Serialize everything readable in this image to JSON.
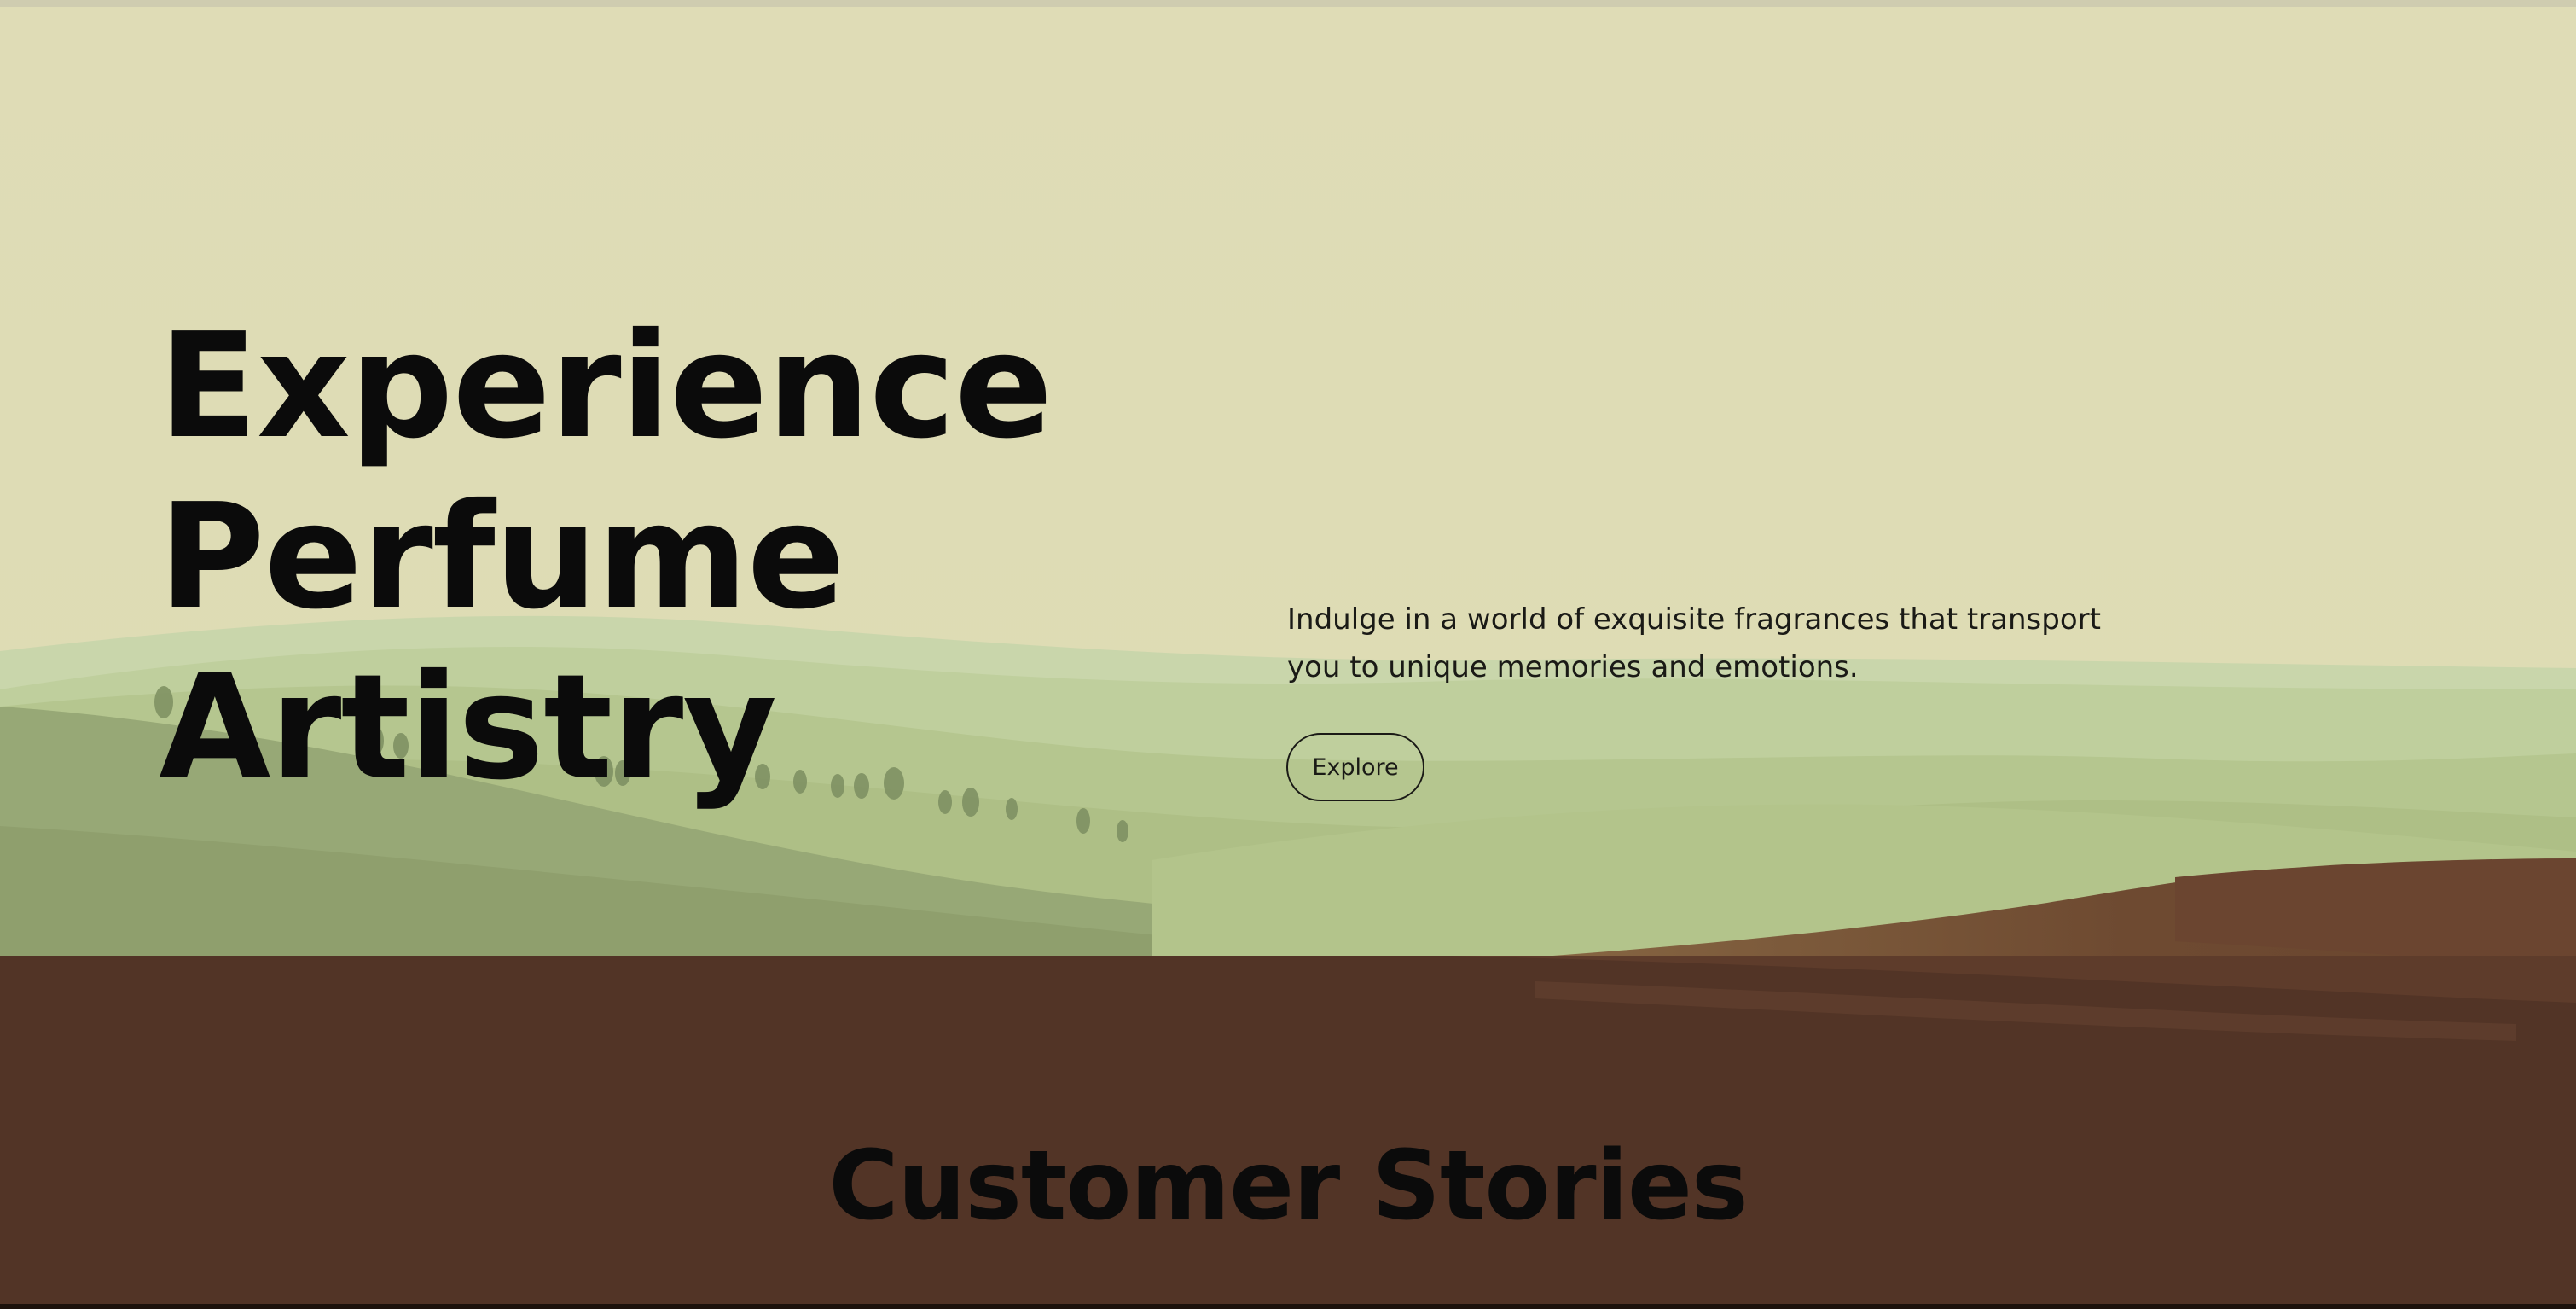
{
  "hero": {
    "title_lines": [
      "Experience",
      "Perfume",
      "Artistry"
    ],
    "description": "Indulge in a world of exquisite fragrances that transport you to unique memories and emotions.",
    "explore_label": "Explore"
  },
  "stories": {
    "title": "Customer Stories"
  },
  "colors": {
    "sky": "#dfdcb6",
    "hills_light": "#c5d3a6",
    "hills_mid": "#adbd87",
    "hills_dark": "#95a574",
    "earth": "#6d4a32",
    "section_dark": "#523426",
    "text": "#0b0b0b"
  }
}
